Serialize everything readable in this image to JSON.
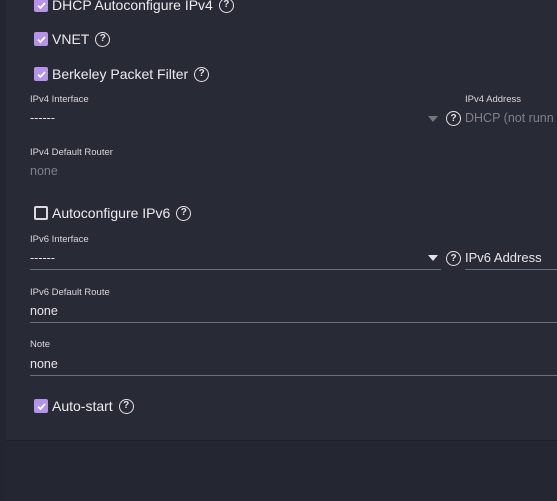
{
  "options": {
    "dhcp": {
      "label": "DHCP Autoconfigure IPv4",
      "checked": true
    },
    "vnet": {
      "label": "VNET",
      "checked": true
    },
    "bpf": {
      "label": "Berkeley Packet Filter",
      "checked": true
    },
    "autoconf_ipv6": {
      "label": "Autoconfigure IPv6",
      "checked": false
    },
    "autostart": {
      "label": "Auto-start",
      "checked": true
    }
  },
  "help_glyph": "?",
  "ipv4": {
    "interface_label": "IPv4 Interface",
    "interface_value": "------",
    "address_label": "IPv4 Address",
    "address_value": "DHCP (not runn",
    "default_router_label": "IPv4 Default Router",
    "default_router_value": "none"
  },
  "ipv6": {
    "interface_label": "IPv6 Interface",
    "interface_value": "------",
    "address_placeholder": "IPv6 Address",
    "default_route_label": "IPv6 Default Route",
    "default_route_value": "none"
  },
  "note": {
    "label": "Note",
    "value": "none"
  },
  "colors": {
    "checkbox_accent": "#b493e8",
    "background": "#282a36"
  }
}
